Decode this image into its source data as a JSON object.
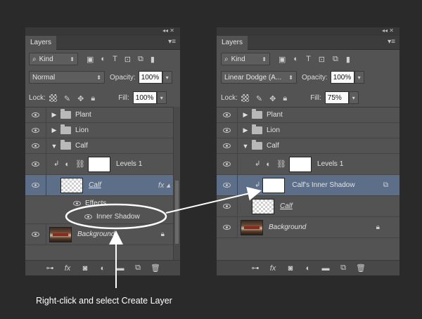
{
  "panel_left": {
    "tab": "Layers",
    "filter_kind": "Kind",
    "blend_mode": "Normal",
    "opacity_label": "Opacity:",
    "opacity_value": "100%",
    "lock_label": "Lock:",
    "fill_label": "Fill:",
    "fill_value": "100%",
    "layers": {
      "plant": "Plant",
      "lion": "Lion",
      "calf_group": "Calf",
      "levels": "Levels 1",
      "calf": "Calf",
      "effects": "Effects",
      "inner_shadow": "Inner Shadow",
      "background": "Background"
    }
  },
  "panel_right": {
    "tab": "Layers",
    "filter_kind": "Kind",
    "blend_mode": "Linear Dodge (A...",
    "opacity_label": "Opacity:",
    "opacity_value": "100%",
    "lock_label": "Lock:",
    "fill_label": "Fill:",
    "fill_value": "75%",
    "layers": {
      "plant": "Plant",
      "lion": "Lion",
      "calf_group": "Calf",
      "levels": "Levels 1",
      "inner_shadow_layer": "Calf's Inner Shadow",
      "calf": "Calf",
      "background": "Background"
    }
  },
  "callout_text": "Right-click and select Create Layer",
  "colors": {
    "selected_row": "#5c6e88",
    "panel_bg": "#535353",
    "page_bg": "#2a2a2a",
    "annotation": "#ffffff"
  }
}
